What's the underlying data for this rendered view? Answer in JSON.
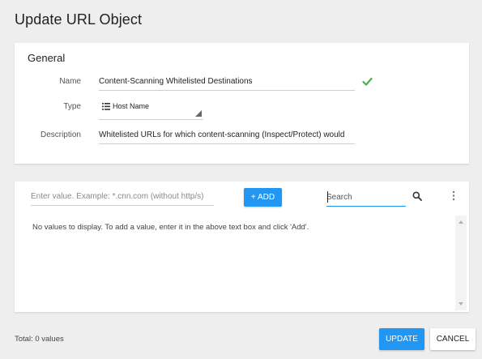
{
  "dialog": {
    "title": "Update URL Object"
  },
  "general": {
    "section_title": "General",
    "name": {
      "label": "Name",
      "value": "Content-Scanning Whitelisted Destinations",
      "valid_icon": "check-icon"
    },
    "type": {
      "label": "Type",
      "value": "Host Name",
      "icon": "list-icon"
    },
    "description": {
      "label": "Description",
      "value": "Whitelisted URLs for which content-scanning (Inspect/Protect) would"
    }
  },
  "values": {
    "input_placeholder": "Enter value. Example: *.cnn.com (without http/s)",
    "add_label": "+ ADD",
    "search_placeholder": "Search",
    "search_icon": "search-icon",
    "more_icon": "more-vertical-icon",
    "empty_message": "No values to display. To add a value, enter it in the above text box and click 'Add'."
  },
  "footer": {
    "total": "Total: 0 values",
    "update_label": "UPDATE",
    "cancel_label": "CANCEL"
  },
  "colors": {
    "accent": "#2196f3",
    "valid": "#4caf50",
    "background": "#eeeeee"
  }
}
